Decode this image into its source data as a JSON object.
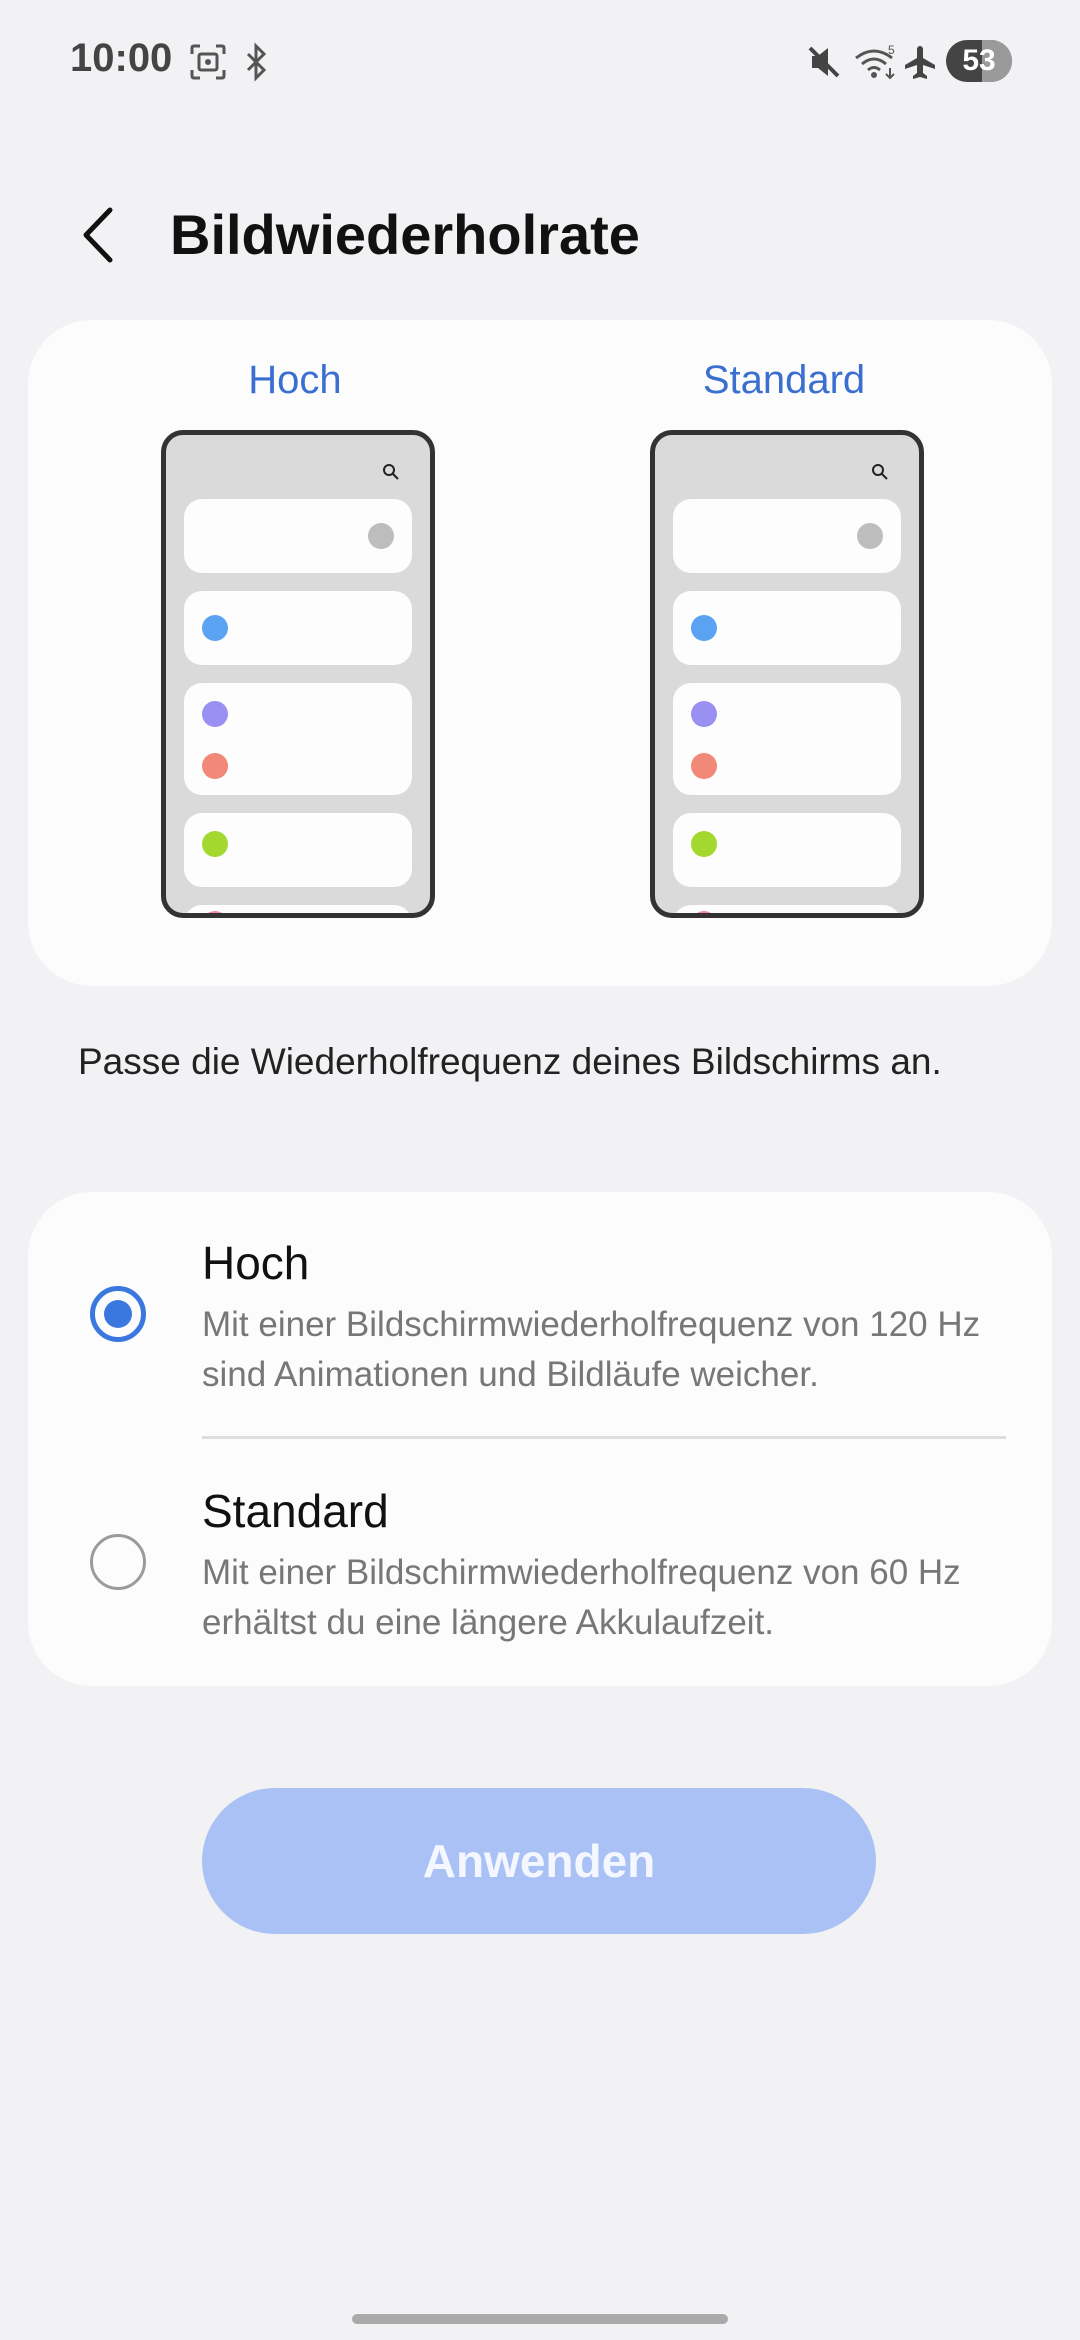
{
  "status_bar": {
    "time": "10:00",
    "icons": [
      "screenshot-icon",
      "bluetooth-icon",
      "mute-icon",
      "wifi-icon",
      "airplane-icon"
    ],
    "battery": "53"
  },
  "header": {
    "back_icon": "chevron-left-icon",
    "title": "Bildwiederholrate"
  },
  "preview": {
    "left_label": "Hoch",
    "right_label": "Standard",
    "dot_colors": {
      "gray": "#bdbdbd",
      "blue": "#5aa3f2",
      "purple": "#9a8ff2",
      "red": "#f28878",
      "green": "#a3d82e",
      "pink": "#f08aa0"
    }
  },
  "description": "Passe die Wiederholfrequenz deines Bildschirms an.",
  "options": [
    {
      "title": "Hoch",
      "description": "Mit einer Bildschirmwiederholfrequenz von 120 Hz sind Animationen und Bildläufe weicher.",
      "selected": true
    },
    {
      "title": "Standard",
      "description": "Mit einer Bildschirmwiederholfrequenz von 60 Hz erhältst du eine längere Akkulaufzeit.",
      "selected": false
    }
  ],
  "apply_label": "Anwenden",
  "colors": {
    "accent": "#3a78e0",
    "label_blue": "#3a6fd0",
    "button_disabled": "#a9c1f5"
  }
}
